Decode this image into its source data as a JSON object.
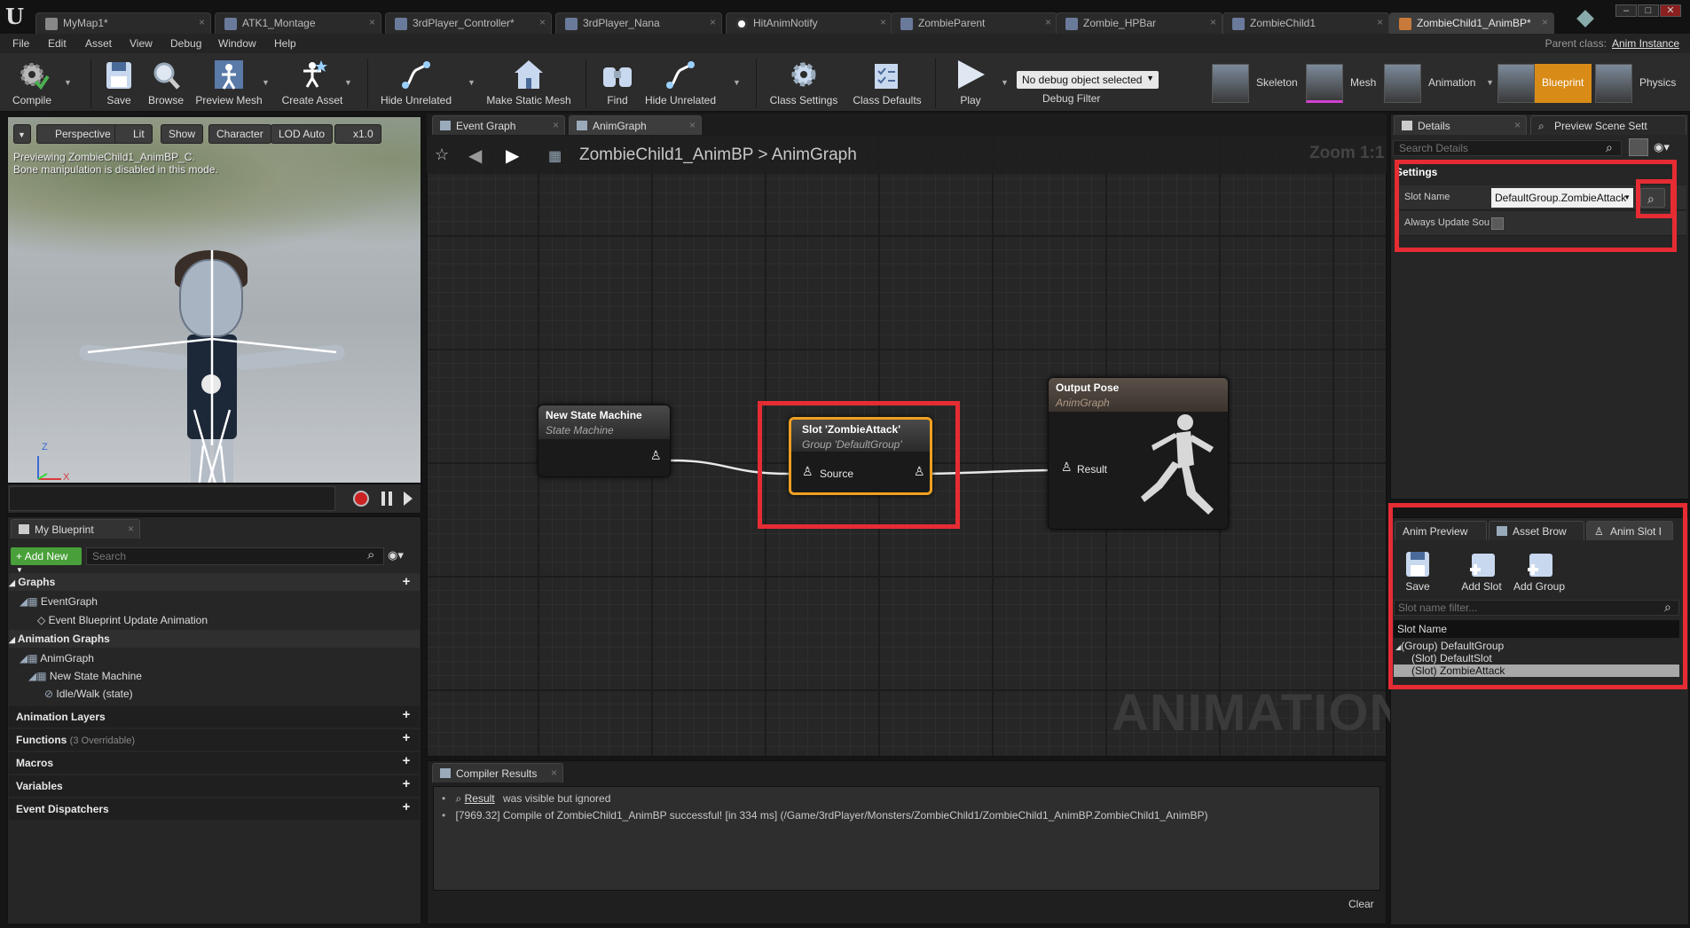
{
  "document_tabs": [
    {
      "label": "MyMap1*",
      "active": false
    },
    {
      "label": "ATK1_Montage",
      "active": false
    },
    {
      "label": "3rdPlayer_Controller*",
      "active": false
    },
    {
      "label": "3rdPlayer_Nana",
      "active": false
    },
    {
      "label": "HitAnimNotify",
      "active": false
    },
    {
      "label": "ZombieParent",
      "active": false
    },
    {
      "label": "Zombie_HPBar",
      "active": false
    },
    {
      "label": "ZombieChild1",
      "active": false
    },
    {
      "label": "ZombieChild1_AnimBP*",
      "active": true
    }
  ],
  "menu": [
    "File",
    "Edit",
    "Asset",
    "View",
    "Debug",
    "Window",
    "Help"
  ],
  "parent_class": {
    "label": "Parent class:",
    "value": "Anim Instance"
  },
  "toolbar": {
    "compile": "Compile",
    "save": "Save",
    "browse": "Browse",
    "preview_mesh": "Preview Mesh",
    "create_asset": "Create Asset",
    "hide_unrelated": "Hide Unrelated",
    "make_static_mesh": "Make Static Mesh",
    "find": "Find",
    "hide_unrelated_2": "Hide Unrelated",
    "class_settings": "Class Settings",
    "class_defaults": "Class Defaults",
    "play": "Play",
    "debug_select": "No debug object selected",
    "debug_filter": "Debug Filter"
  },
  "modes": [
    {
      "label": "Skeleton",
      "active": false
    },
    {
      "label": "Mesh",
      "active": false
    },
    {
      "label": "Animation",
      "active": false
    },
    {
      "label": "Blueprint",
      "active": true
    },
    {
      "label": "Physics",
      "active": false
    }
  ],
  "viewport": {
    "buttons": {
      "perspective": "Perspective",
      "lit": "Lit",
      "show": "Show",
      "character": "Character",
      "lod": "LOD Auto",
      "speed": "x1.0"
    },
    "line1": "Previewing ZombieChild1_AnimBP_C.",
    "line2": "Bone manipulation is disabled in this mode.",
    "axis_z": "Z",
    "axis_x": "X"
  },
  "my_blueprint": {
    "tab": "My Blueprint",
    "add_new": "Add New",
    "search_placeholder": "Search",
    "graphs": "Graphs",
    "event_graph": "EventGraph",
    "event_update": "Event Blueprint Update Animation",
    "animation_graphs": "Animation Graphs",
    "anim_graph": "AnimGraph",
    "new_state_machine": "New State Machine",
    "idle_walk": "Idle/Walk (state)",
    "animation_layers": "Animation Layers",
    "functions": "Functions",
    "functions_note": "(3 Overridable)",
    "macros": "Macros",
    "variables": "Variables",
    "event_dispatchers": "Event Dispatchers"
  },
  "graph": {
    "tabs": [
      "Event Graph",
      "AnimGraph"
    ],
    "breadcrumb_root": "ZombieChild1_AnimBP",
    "breadcrumb_sep": ">",
    "breadcrumb_leaf": "AnimGraph",
    "zoom": "Zoom 1:1",
    "watermark": "ANIMATION",
    "nodes": {
      "state_machine": {
        "title": "New State Machine",
        "subtitle": "State Machine"
      },
      "slot": {
        "title": "Slot 'ZombieAttack'",
        "subtitle": "Group 'DefaultGroup'",
        "pin": "Source"
      },
      "output": {
        "title": "Output Pose",
        "subtitle": "AnimGraph",
        "pin": "Result"
      }
    }
  },
  "compiler": {
    "tab": "Compiler Results",
    "line1_link": "Result",
    "line1_text": "was visible but ignored",
    "line2": "[7969.32] Compile of ZombieChild1_AnimBP successful! [in 334 ms] (/Game/3rdPlayer/Monsters/ZombieChild1/ZombieChild1_AnimBP.ZombieChild1_AnimBP)",
    "clear": "Clear"
  },
  "details": {
    "tab": "Details",
    "tab2": "Preview Scene Sett",
    "search_placeholder": "Search Details",
    "section": "Settings",
    "slot_name_label": "Slot Name",
    "slot_name_value": "DefaultGroup.ZombieAttack",
    "always_update_label": "Always Update Sou"
  },
  "slot_manager": {
    "tabs": [
      "Anim Preview",
      "Asset Brow",
      "Anim Slot I"
    ],
    "save": "Save",
    "add_slot": "Add Slot",
    "add_group": "Add Group",
    "filter_placeholder": "Slot name filter...",
    "column": "Slot Name",
    "items": [
      {
        "label": "(Group) DefaultGroup",
        "selected": false
      },
      {
        "label": "(Slot) DefaultSlot",
        "selected": false
      },
      {
        "label": "(Slot) ZombieAttack",
        "selected": true
      }
    ]
  },
  "colors": {
    "highlight_red": "#e62c33",
    "slot_node_border": "#f0a020",
    "blueprint_mode_active": "#d98b17",
    "add_new_green": "#49a03a"
  }
}
